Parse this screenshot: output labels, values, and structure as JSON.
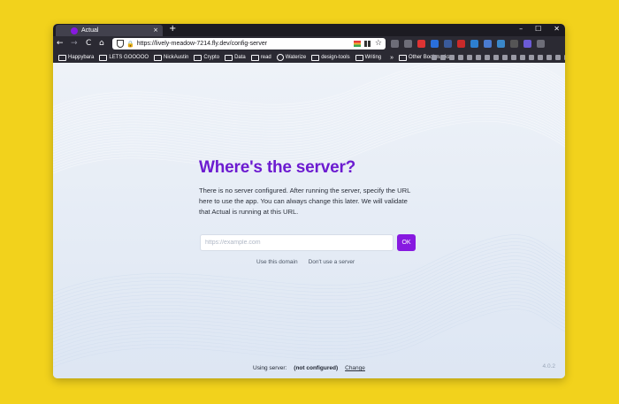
{
  "browser": {
    "tab_title": "Actual",
    "url": "https://lively-meadow-7214.fly.dev/config-server",
    "new_tab": "+",
    "close_tab": "×",
    "window_controls": [
      "–",
      "☐",
      "✕"
    ],
    "nav": {
      "back": "←",
      "forward": "→",
      "reload": "C",
      "home": "⌂"
    },
    "star": "☆",
    "bookmarks": [
      {
        "label": "Happybara",
        "icon": "folder-icon"
      },
      {
        "label": "LETS GOOOOO",
        "icon": "folder-icon"
      },
      {
        "label": "NickAustin",
        "icon": "folder-icon"
      },
      {
        "label": "Crypto",
        "icon": "folder-icon"
      },
      {
        "label": "Data",
        "icon": "folder-icon"
      },
      {
        "label": "read",
        "icon": "folder-icon"
      },
      {
        "label": "Waterize",
        "icon": "globe-icon"
      },
      {
        "label": "design-tools",
        "icon": "folder-icon"
      },
      {
        "label": "Writing",
        "icon": "folder-icon"
      }
    ],
    "bookmarks_more": "»",
    "other_bookmarks": "Other Bookmarks"
  },
  "page": {
    "title": "Where's the server?",
    "description": "There is no server configured. After running the server, specify the URL here to use the app. You can always change this later. We will validate that Actual is running at this URL.",
    "input_placeholder": "https://example.com",
    "ok_label": "OK",
    "use_domain_label": "Use this domain",
    "no_server_label": "Don't use a server",
    "footer_prefix": "Using server:",
    "footer_status": "(not configured)",
    "footer_change": "Change",
    "version": "4.0.2"
  },
  "colors": {
    "accent": "#8719e0",
    "title": "#6c1bd0",
    "desktop": "#f2d21c"
  }
}
